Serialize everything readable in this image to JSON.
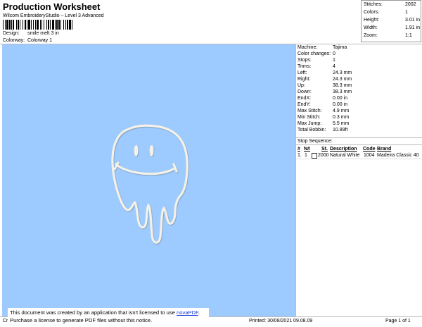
{
  "header": {
    "title": "Production Worksheet",
    "subtitle": "Wilcom EmbroideryStudio – Level 3 Advanced",
    "design_label": "Design:",
    "design_value": "smile melt 3 in",
    "colorway_label": "Colorway:",
    "colorway_value": "Colorway 1"
  },
  "summary": [
    {
      "label": "Stitches:",
      "value": "2002"
    },
    {
      "label": "Colors:",
      "value": "1"
    },
    {
      "label": "Height:",
      "value": "3.01 in"
    },
    {
      "label": "Width:",
      "value": "1.91 in"
    },
    {
      "label": "Zoom:",
      "value": "1:1"
    }
  ],
  "details": [
    {
      "label": "Machine:",
      "value": "Tajima"
    },
    {
      "label": "Color changes:",
      "value": "0"
    },
    {
      "label": "Stops:",
      "value": "1"
    },
    {
      "label": "Trims:",
      "value": "4"
    },
    {
      "label": "Left:",
      "value": "24.3 mm"
    },
    {
      "label": "Right:",
      "value": "24.3 mm"
    },
    {
      "label": "Up:",
      "value": "38.3 mm"
    },
    {
      "label": "Down:",
      "value": "38.3 mm"
    },
    {
      "label": "EndX:",
      "value": "0.00 in"
    },
    {
      "label": "EndY:",
      "value": "0.00 in"
    },
    {
      "label": "Max Stitch:",
      "value": "4.9 mm"
    },
    {
      "label": "Min Stitch:",
      "value": "0.3 mm"
    },
    {
      "label": "Max Jump:",
      "value": "5.5 mm"
    },
    {
      "label": "Total Bobbin:",
      "value": "10.89ft"
    }
  ],
  "stop_sequence": {
    "title": "Stop Sequence:",
    "headers": [
      "#",
      "N#",
      "St.",
      "Description",
      "Code",
      "Brand"
    ],
    "rows": [
      {
        "num": "1.",
        "n": "1",
        "st": "2000",
        "description": "Natural White",
        "code": "1004",
        "brand": "Madeira Classic 40",
        "swatch": "#ffffff"
      }
    ]
  },
  "colors": {
    "canvas": "#9ecbff",
    "thread": "#f4f1e6"
  },
  "footer": {
    "left": "Cr",
    "printed": "Printed: 30/08/2021 09.08.09",
    "page": "Page 1 of 1"
  },
  "notice": {
    "line1": "This document was created by an application that isn't licensed to use ",
    "link": "novaPDF",
    "line1_end": ".",
    "line2": "Purchase a license to generate PDF files without this notice."
  }
}
